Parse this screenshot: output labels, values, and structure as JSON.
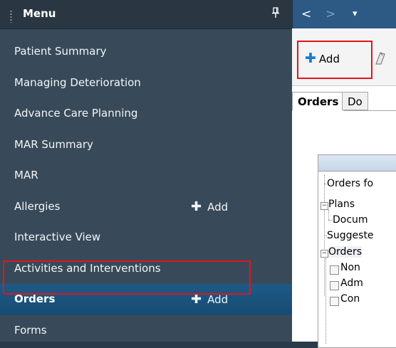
{
  "menu": {
    "title": "Menu",
    "items": [
      {
        "label": "Patient Summary",
        "add": ""
      },
      {
        "label": "Managing Deterioration",
        "add": ""
      },
      {
        "label": "Advance Care Planning",
        "add": ""
      },
      {
        "label": "MAR Summary",
        "add": ""
      },
      {
        "label": "MAR",
        "add": ""
      },
      {
        "label": "Allergies",
        "add": "Add"
      },
      {
        "label": "Interactive View",
        "add": ""
      },
      {
        "label": "Activities and Interventions",
        "add": ""
      },
      {
        "label": "Orders",
        "add": "Add",
        "selected": true
      },
      {
        "label": "Forms",
        "add": ""
      }
    ]
  },
  "nav": {
    "back": "<",
    "forward": ">",
    "dropdown": "▾"
  },
  "toolbar": {
    "add_label": "Add"
  },
  "tabs": [
    {
      "label": "Orders",
      "active": true
    },
    {
      "label": "Do",
      "active": false
    }
  ],
  "tree": {
    "nodes": [
      {
        "label": "Orders fo"
      },
      {
        "label": "Plans"
      },
      {
        "label": "Docum"
      },
      {
        "label": "Suggeste"
      },
      {
        "label": "Orders"
      },
      {
        "label": "Non"
      },
      {
        "label": "Adm"
      },
      {
        "label": "Con"
      }
    ]
  },
  "colors": {
    "menu_bg": "#384a59",
    "selected_bg": "#1d5a86",
    "highlight": "#e0161b",
    "nav_bg": "#2d5a85",
    "add_icon": "#1a7cc7"
  }
}
